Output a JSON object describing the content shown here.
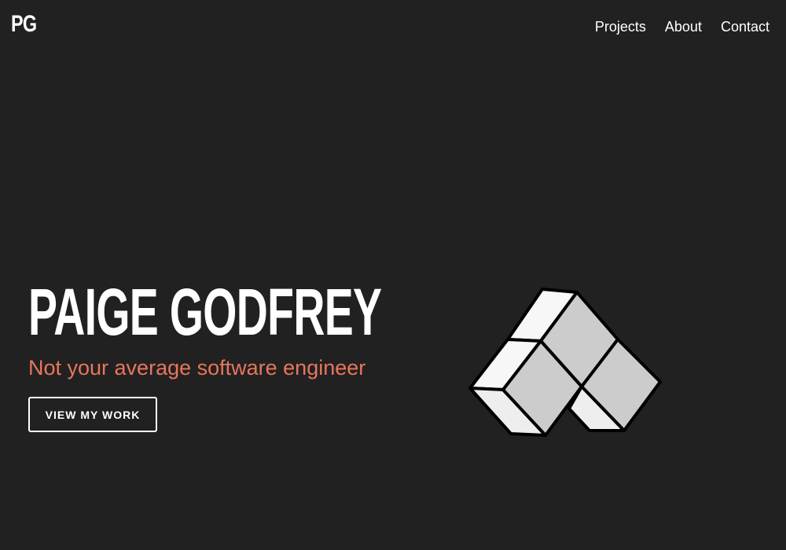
{
  "header": {
    "logo": "PG",
    "nav": [
      {
        "label": "Projects"
      },
      {
        "label": "About"
      },
      {
        "label": "Contact"
      }
    ]
  },
  "hero": {
    "title": "PAIGE GODFREY",
    "subtitle": "Not your average software engineer",
    "cta_label": "VIEW MY WORK",
    "illustration": "isometric-blocks-icon"
  },
  "colors": {
    "background": "#212121",
    "text": "#ffffff",
    "accent": "#e8765c",
    "block_top": "#cccccc",
    "block_side": "#f7f7f7",
    "block_bottom": "#eeeeee"
  }
}
